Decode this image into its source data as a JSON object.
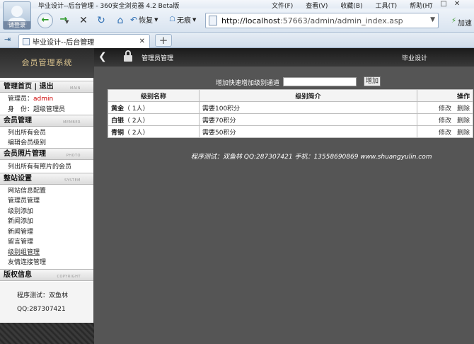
{
  "browser": {
    "avatar_label": "请登录",
    "window_title": "毕业设计--后台管理 - 360安全浏览器 4.2 Beta版",
    "menu": [
      "文件(F)",
      "查看(V)",
      "收藏(B)",
      "工具(T)",
      "帮助(H)"
    ],
    "controls": {
      "minimize": "−",
      "restore": "□",
      "close": "✕"
    },
    "restore_label": "恢复",
    "trace_label": "无痕",
    "url_host": "http://localhost",
    "url_rest": ":57663/admin/admin_index.asp",
    "accelerate_label": "加速",
    "tab_title": "毕业设计--后台管理",
    "tab_close": "✕",
    "newtab_label": "+"
  },
  "sidebar": {
    "logo_text": "会员管理系统",
    "admin_header": {
      "label": "管理首页 | 退出",
      "en": "MAIN"
    },
    "admin_user_label": "管理员：",
    "admin_user": "admin",
    "admin_role_label": "身　份：",
    "admin_role": "超级管理员",
    "member_header": {
      "label": "会员管理",
      "en": "MEMBER"
    },
    "member_items": [
      "列出所有会员",
      "编辑会员级别"
    ],
    "photo_header": {
      "label": "会员照片管理",
      "en": "PHOTO"
    },
    "photo_items": [
      "列出所有有照片的会员"
    ],
    "system_header": {
      "label": "整站设置",
      "en": "SYSTEM"
    },
    "system_items": [
      "网站信息配置",
      "管理员管理",
      "级别添加",
      "新闻添加",
      "新闻管理",
      "留言管理",
      "级别组管理",
      "友情连接管理"
    ],
    "copyright_header": {
      "label": "版权信息",
      "en": "COPYRIGHT"
    },
    "copyright_lines": [
      "程序测试：双鱼林",
      "QQ:287307421"
    ]
  },
  "main": {
    "header_title": "管理员管理",
    "site_name": "毕业设计",
    "quick_label": "增加快速增加级别通道",
    "quick_input_value": "",
    "add_button": "增加",
    "table": {
      "headers": [
        "级别名称",
        "级别简介",
        "操作"
      ],
      "rows": [
        {
          "name": "黄金",
          "count": "（ 1人）",
          "desc": "需要100积分",
          "edit": "修改",
          "del": "删除"
        },
        {
          "name": "白银",
          "count": "（ 2人）",
          "desc": "需要70积分",
          "edit": "修改",
          "del": "删除"
        },
        {
          "name": "青铜",
          "count": "（ 2人）",
          "desc": "需要50积分",
          "edit": "修改",
          "del": "删除"
        }
      ]
    },
    "footnote": "程序测试：双鱼林  QQ:287307421  手机：13558690869 www.shuangyulin.com"
  }
}
